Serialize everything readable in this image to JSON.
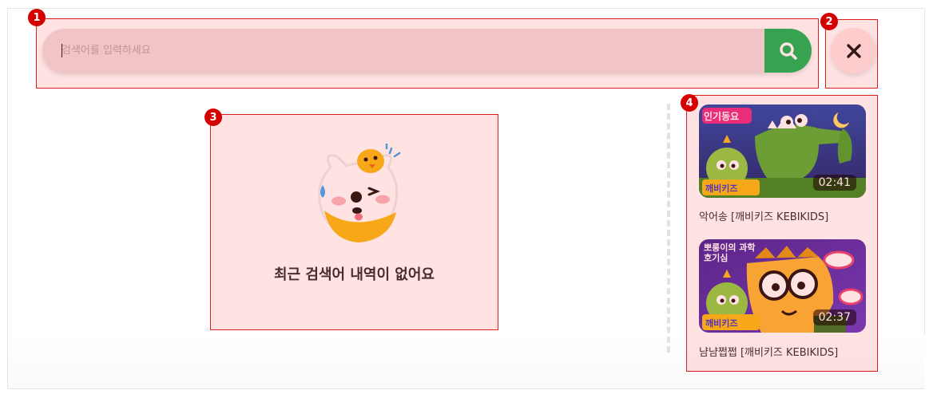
{
  "search": {
    "placeholder": "검색어를 입력하세요",
    "value": ""
  },
  "empty_state": {
    "message": "최근 검색어 내역이 없어요"
  },
  "videos": [
    {
      "badge_text": "인기동요",
      "brand_text": "깨비키즈",
      "duration": "02:41",
      "title": "악어송 [깨비키즈 KEBIKIDS]"
    },
    {
      "badge_text": "뽀롱이의 과학호기심",
      "brand_text": "깨비키즈",
      "duration": "02:37",
      "title": "냠냠쩝쩝 [깨비키즈 KEBIKIDS]"
    }
  ],
  "annotations": [
    "1",
    "2",
    "3",
    "4"
  ],
  "colors": {
    "accent_green": "#1fb85a",
    "annotation_red": "#d40000",
    "search_bg": "#f0dede"
  }
}
